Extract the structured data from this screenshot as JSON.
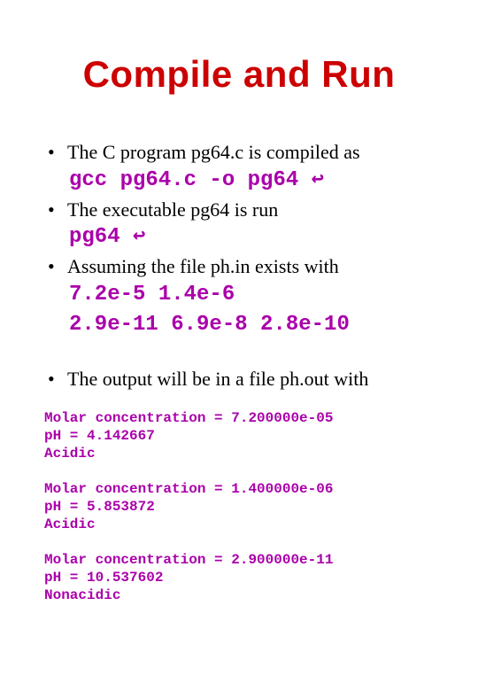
{
  "title": "Compile and Run",
  "bullets": {
    "b1": "The C program pg64.c is compiled as",
    "b2": "The executable pg64 is run",
    "b3": "Assuming the file ph.in exists with",
    "b4": "The output will be in a file ph.out with"
  },
  "code": {
    "compile": "gcc pg64.c -o pg64 ↩",
    "run": "pg64 ↩",
    "input1": "7.2e-5 1.4e-6",
    "input2": "2.9e-11 6.9e-8 2.8e-10"
  },
  "outputs": {
    "o1": "Molar concentration = 7.200000e-05\npH = 4.142667\nAcidic",
    "o2": "Molar concentration = 1.400000e-06\npH = 5.853872\nAcidic",
    "o3": "Molar concentration = 2.900000e-11\npH = 10.537602\nNonacidic"
  }
}
